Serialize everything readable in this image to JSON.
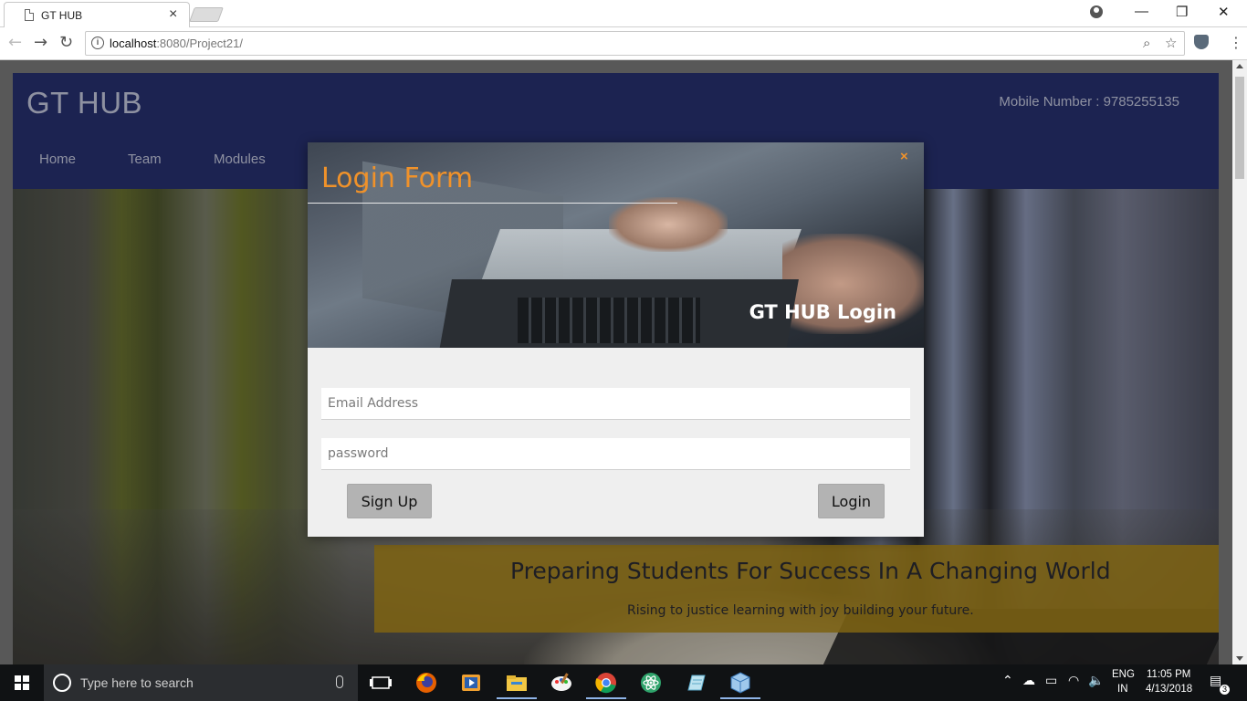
{
  "browser": {
    "tab_title": "GT HUB",
    "tab_close": "×",
    "url_host": "localhost",
    "url_rest": ":8080/Project21/",
    "window_controls": {
      "minimize": "—",
      "restore": "❐",
      "close": "✕"
    }
  },
  "site": {
    "logo": "GT HUB",
    "phone": "Mobile Number : 9785255135",
    "nav": [
      "Home",
      "Team",
      "Modules"
    ],
    "header_color": "#283171"
  },
  "banner": {
    "title": "Preparing Students For Success In A Changing World",
    "subtitle": "Rising to justice learning with joy building your future.",
    "color": "#ad891b"
  },
  "modal": {
    "title": "Login Form",
    "close": "×",
    "subtitle": "GT HUB Login",
    "email_placeholder": "Email Address",
    "password_placeholder": "password",
    "signup_label": "Sign Up",
    "login_label": "Login",
    "accent_color": "#f0922a"
  },
  "taskbar": {
    "search_placeholder": "Type here to search",
    "lang_line1": "ENG",
    "lang_line2": "IN",
    "time": "11:05 PM",
    "date": "4/13/2018",
    "notification_count": "3",
    "apps": [
      "task-view-icon",
      "firefox-icon",
      "media-player-icon",
      "file-explorer-icon",
      "paint-icon",
      "chrome-icon",
      "atom-icon",
      "notes-icon",
      "virtualbox-icon"
    ]
  }
}
